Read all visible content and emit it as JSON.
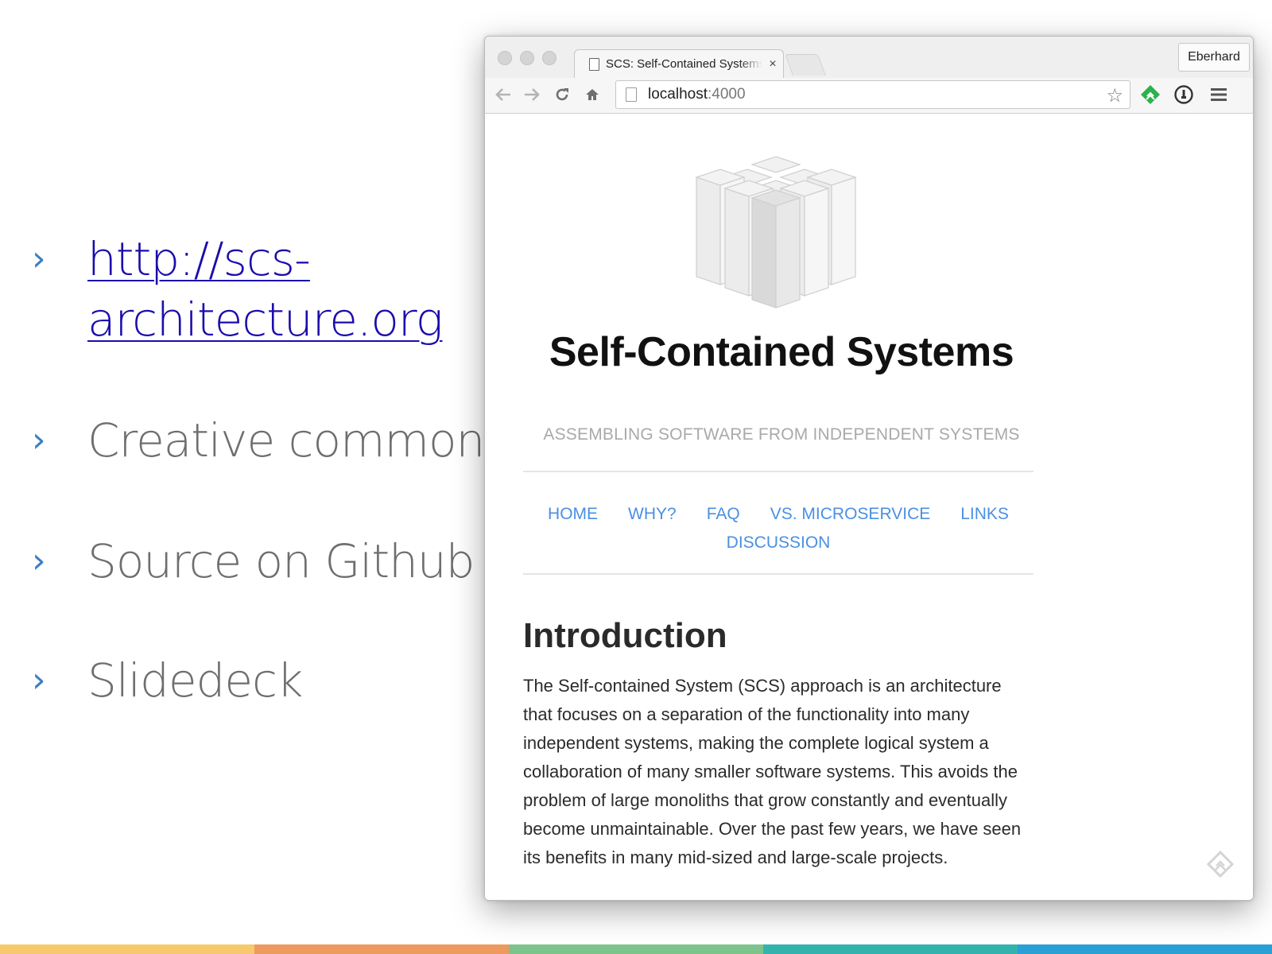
{
  "slide": {
    "bullets": [
      {
        "line1": "http://scs-",
        "line2": "architecture.org"
      },
      {
        "text": "Creative commons"
      },
      {
        "text": "Source on Github"
      },
      {
        "text": "Slidedeck"
      }
    ],
    "bullet_icon": "chevron-right-icon",
    "strip_colors": [
      "#f6c96b",
      "#ee9a5e",
      "#7cc48c",
      "#34b3ad",
      "#2aa0d6"
    ]
  },
  "browser": {
    "tab": {
      "title": "SCS: Self-Contained Systems",
      "close": "×"
    },
    "profile": "Eberhard",
    "url": {
      "host": "localhost",
      "port": ":4000"
    }
  },
  "page": {
    "title": "Self-Contained Systems",
    "subtitle": "ASSEMBLING SOFTWARE FROM INDEPENDENT SYSTEMS",
    "nav": {
      "home": "HOME",
      "why": "WHY?",
      "faq": "FAQ",
      "vs": "VS. MICROSERVICE",
      "links": "LINKS",
      "discussion": "DISCUSSION"
    },
    "intro_heading": "Introduction",
    "intro_text": "The Self-contained System (SCS) approach is an architecture that focuses on a separation of the functionality into many independent systems, making the complete logical system a collaboration of many smaller software systems. This avoids the problem of large monoliths that grow constantly and eventually become unmaintainable. Over the past few years, we have seen its benefits in many mid-sized and large-scale projects.",
    "link_color": "#4a90e2"
  }
}
